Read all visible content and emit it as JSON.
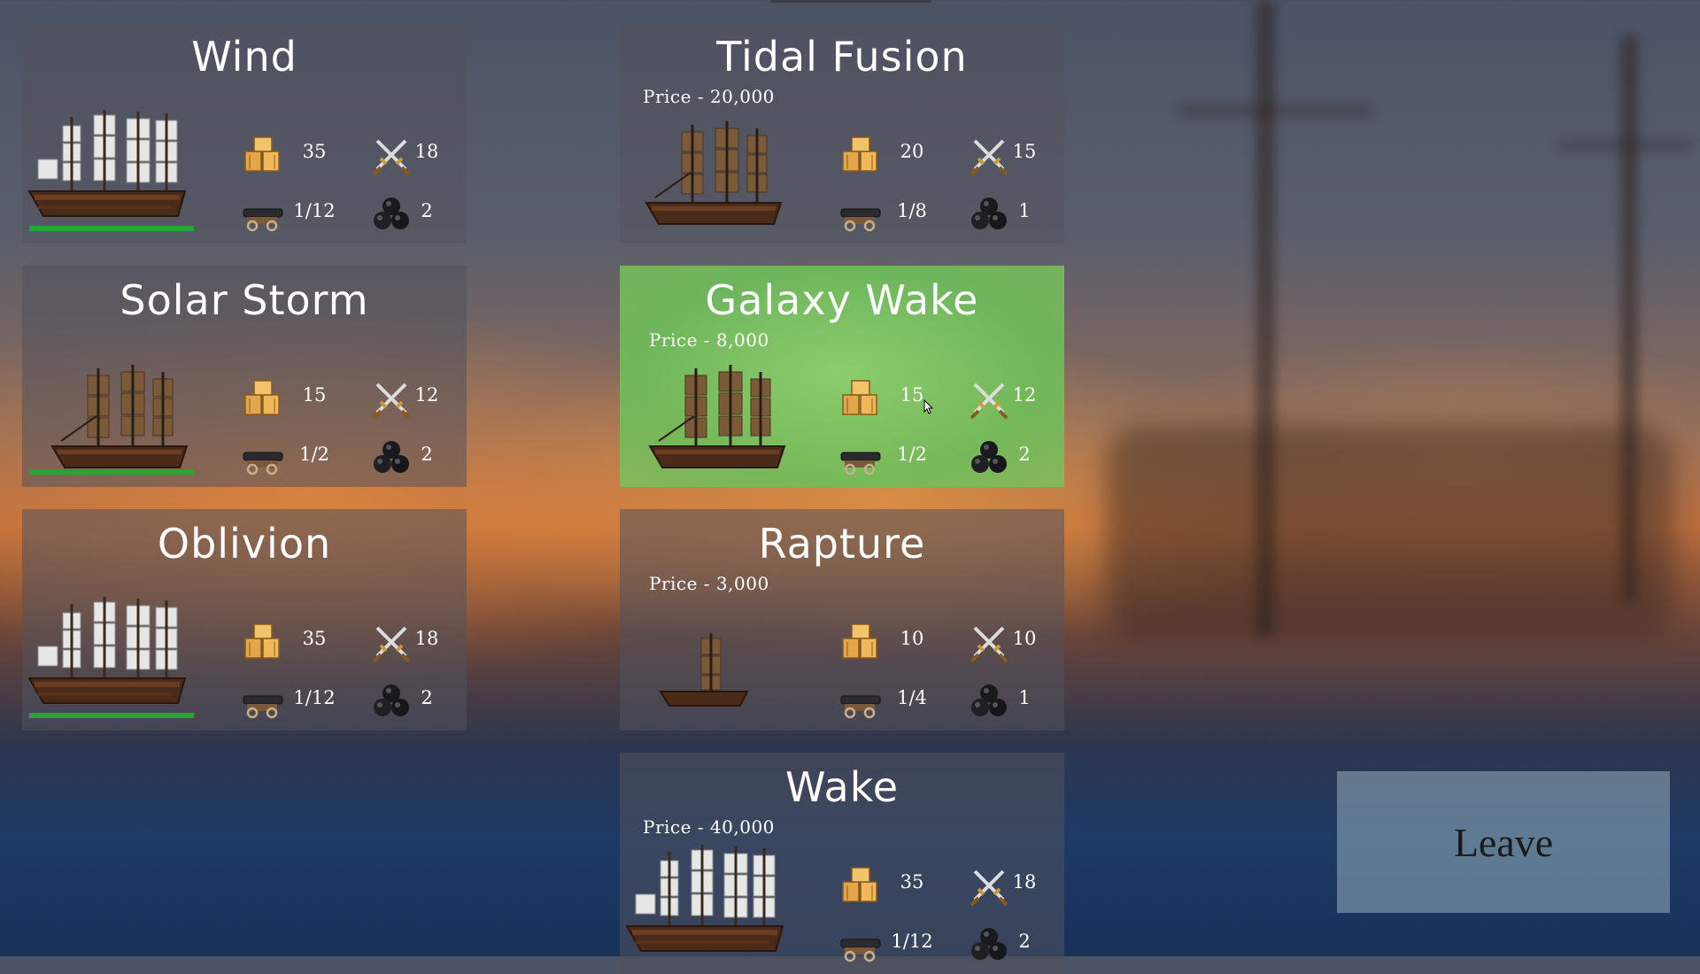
{
  "ships": [
    {
      "name": "Wind",
      "price": "",
      "cargo": "35",
      "crew": "18",
      "cannons": "1/12",
      "ammo": "2"
    },
    {
      "name": "Solar Storm",
      "price": "",
      "cargo": "15",
      "crew": "12",
      "cannons": "1/2",
      "ammo": "2"
    },
    {
      "name": "Oblivion",
      "price": "",
      "cargo": "35",
      "crew": "18",
      "cannons": "1/12",
      "ammo": "2"
    },
    {
      "name": "Tidal Fusion",
      "price": "Price - 20,000",
      "cargo": "20",
      "crew": "15",
      "cannons": "1/8",
      "ammo": "1"
    },
    {
      "name": "Galaxy Wake",
      "price": "Price - 8,000",
      "cargo": "15",
      "crew": "12",
      "cannons": "1/2",
      "ammo": "2"
    },
    {
      "name": "Rapture",
      "price": "Price - 3,000",
      "cargo": "10",
      "crew": "10",
      "cannons": "1/4",
      "ammo": "1"
    },
    {
      "name": "Wake",
      "price": "Price - 40,000",
      "cargo": "35",
      "crew": "18",
      "cannons": "1/12",
      "ammo": "2"
    }
  ],
  "leave_label": "Leave",
  "colors": {
    "card_bg": "#52525c",
    "selected_bg": "#8cd26e",
    "health_bar": "#27a534",
    "leave_bg": "#96afb9"
  },
  "icons": [
    "cargo-crate-icon",
    "crossed-swords-icon",
    "cannon-icon",
    "cannonball-stack-icon"
  ]
}
